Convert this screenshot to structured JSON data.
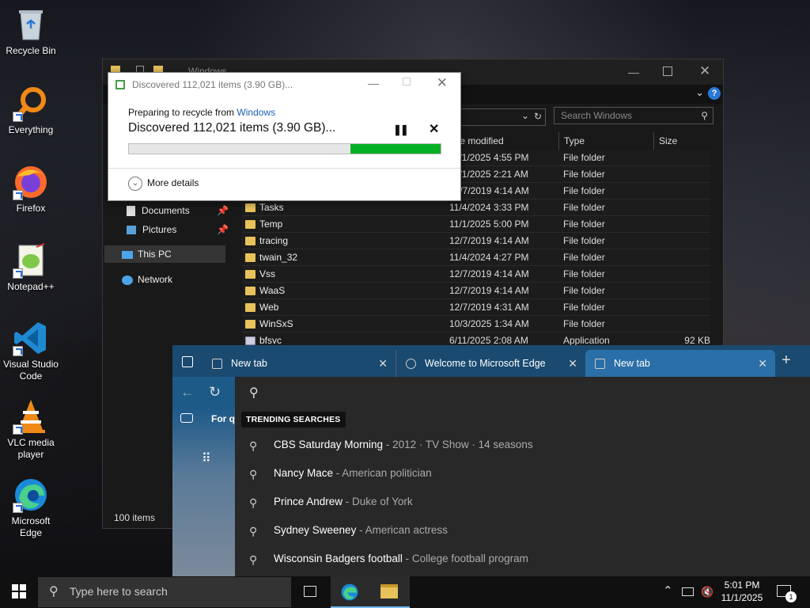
{
  "desktop": {
    "icons": [
      {
        "label": "Recycle Bin",
        "icon": "recycle-bin-icon"
      },
      {
        "label": "Everything",
        "icon": "everything-search-icon"
      },
      {
        "label": "Firefox",
        "icon": "firefox-icon"
      },
      {
        "label": "Notepad++",
        "icon": "notepadpp-icon"
      },
      {
        "label": "Visual Studio Code",
        "icon": "vscode-icon"
      },
      {
        "label": "VLC media player",
        "icon": "vlc-icon"
      },
      {
        "label": "Microsoft Edge",
        "icon": "edge-icon"
      }
    ]
  },
  "explorer": {
    "title": "Windows",
    "search_placeholder": "Search Windows",
    "columns": {
      "date": "te modified",
      "type": "Type",
      "size": "Size"
    },
    "nav": [
      {
        "label": "Documents",
        "pinned": true
      },
      {
        "label": "Pictures",
        "pinned": true
      },
      {
        "label": "This PC",
        "pinned": false
      },
      {
        "label": "Network",
        "pinned": false
      }
    ],
    "rows": [
      {
        "name": "",
        "date": "11/1/2025 4:55 PM",
        "type": "File folder",
        "size": ""
      },
      {
        "name": "",
        "date": "11/1/2025 2:21 AM",
        "type": "File folder",
        "size": ""
      },
      {
        "name": "",
        "date": "12/7/2019 4:14 AM",
        "type": "File folder",
        "size": ""
      },
      {
        "name": "Tasks",
        "date": "11/4/2024 3:33 PM",
        "type": "File folder",
        "size": ""
      },
      {
        "name": "Temp",
        "date": "11/1/2025 5:00 PM",
        "type": "File folder",
        "size": ""
      },
      {
        "name": "tracing",
        "date": "12/7/2019 4:14 AM",
        "type": "File folder",
        "size": ""
      },
      {
        "name": "twain_32",
        "date": "11/4/2024 4:27 PM",
        "type": "File folder",
        "size": ""
      },
      {
        "name": "Vss",
        "date": "12/7/2019 4:14 AM",
        "type": "File folder",
        "size": ""
      },
      {
        "name": "WaaS",
        "date": "12/7/2019 4:14 AM",
        "type": "File folder",
        "size": ""
      },
      {
        "name": "Web",
        "date": "12/7/2019 4:31 AM",
        "type": "File folder",
        "size": ""
      },
      {
        "name": "WinSxS",
        "date": "10/3/2025 1:34 AM",
        "type": "File folder",
        "size": ""
      },
      {
        "name": "bfsvc",
        "date": "6/11/2025 2:08 AM",
        "type": "Application",
        "size": "92 KB"
      }
    ],
    "status": "100 items"
  },
  "recycle_dialog": {
    "title": "Discovered 112,021 items (3.90 GB)...",
    "preparing": "Preparing to recycle from",
    "source": "Windows",
    "headline": "Discovered 112,021 items (3.90 GB)...",
    "progress": 0.29,
    "more_details": "More details"
  },
  "edge": {
    "tabs": [
      {
        "label": "New tab",
        "active": false
      },
      {
        "label": "Welcome to Microsoft Edge",
        "active": false
      },
      {
        "label": "New tab",
        "active": true
      }
    ],
    "page_snippet": "For q",
    "trending_label": "TRENDING SEARCHES",
    "suggestions": [
      {
        "title": "CBS Saturday Morning",
        "desc": "2012 · TV Show · 14 seasons"
      },
      {
        "title": "Nancy Mace",
        "desc": "American politician"
      },
      {
        "title": "Prince Andrew",
        "desc": "Duke of York"
      },
      {
        "title": "Sydney Sweeney",
        "desc": "American actress"
      },
      {
        "title": "Wisconsin Badgers football",
        "desc": "College football program"
      }
    ]
  },
  "taskbar": {
    "search_placeholder": "Type here to search",
    "time": "5:01 PM",
    "date": "11/1/2025",
    "notification_count": "1"
  }
}
